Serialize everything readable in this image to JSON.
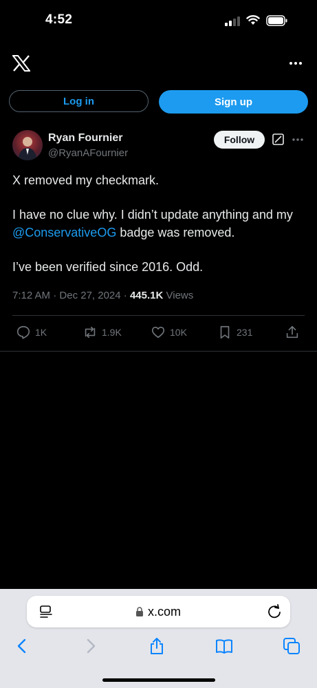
{
  "status": {
    "time": "4:52"
  },
  "header": {
    "logo_icon": "x-logo-icon",
    "more_icon": "more-icon"
  },
  "auth": {
    "login_label": "Log in",
    "signup_label": "Sign up"
  },
  "post": {
    "author_name": "Ryan Fournier",
    "author_handle": "@RyanAFournier",
    "follow_label": "Follow",
    "text_line1": "X removed my checkmark.",
    "text_para2_before": "I have no clue why. I didn’t update anything and my ",
    "mention": "@ConservativeOG",
    "text_para2_after": " badge was removed.",
    "text_para3": "I’ve been verified since 2016. Odd.",
    "time": "7:12 AM",
    "date": "Dec 27, 2024",
    "views_count": "445.1K",
    "views_label": "Views",
    "actions": {
      "replies": "1K",
      "reposts": "1.9K",
      "likes": "10K",
      "bookmarks": "231"
    }
  },
  "browser": {
    "url": "x.com"
  },
  "colors": {
    "accent": "#1d9bf0",
    "background": "#000000",
    "muted": "#71767b"
  }
}
